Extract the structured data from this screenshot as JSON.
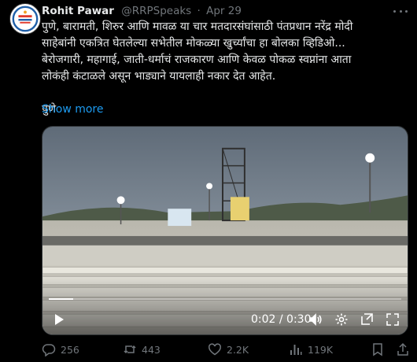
{
  "tweet": {
    "author_name": "Rohit Pawar",
    "author_handle": "@RRPSpeaks",
    "separator": "·",
    "timestamp": "Apr 29",
    "lines": [
      "पुणे, बारामती, शिरुर आणि मावळ या चार मतदारसंघांसाठी पंतप्रधान नरेंद्र मोदी",
      "साहेबांनी एकत्रित घेतलेल्या सभेतील मोकळ्या खुर्च्यांचा हा बोलका व्हिडिओ...",
      "बेरोजगारी, महागाई, जाती-धर्माचं राजकारण आणि केवळ पोकळ स्वप्नांना आता",
      "लोकंही कंटाळले असून भाड्याने यायलाही नकार देत आहेत."
    ],
    "location_line": "पुणे",
    "show_more": "Show more"
  },
  "video": {
    "timecode": "0:02 / 0:30",
    "progress_fraction": 0.07,
    "controls": [
      "play-icon",
      "volume-icon",
      "settings-icon",
      "picture-in-picture-icon",
      "fullscreen-icon"
    ]
  },
  "actions": {
    "replies": "256",
    "reposts": "443",
    "likes": "2.2K",
    "views": "119K"
  },
  "colors": {
    "background": "#000000",
    "text": "#e7e9ea",
    "muted": "#71767b",
    "link": "#1d9bf0",
    "border": "#2f3336"
  }
}
